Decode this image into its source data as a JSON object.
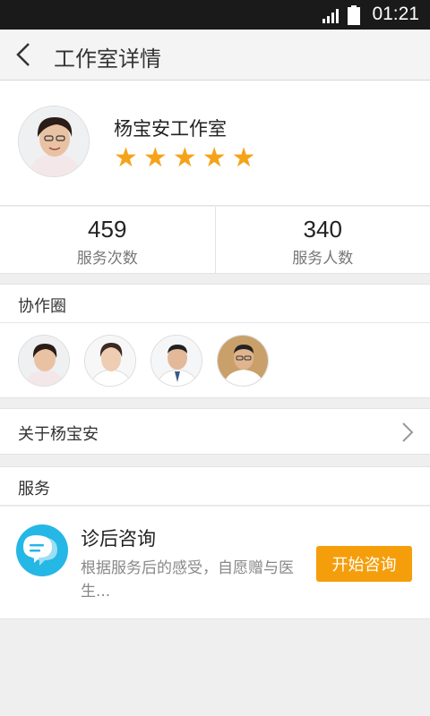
{
  "status_bar": {
    "time": "01:21"
  },
  "header": {
    "title": "工作室详情"
  },
  "profile": {
    "name": "杨宝安工作室",
    "rating": 5
  },
  "stats": [
    {
      "value": "459",
      "label": "服务次数"
    },
    {
      "value": "340",
      "label": "服务人数"
    }
  ],
  "collaboration": {
    "title": "协作圈",
    "member_count": 4
  },
  "about": {
    "label": "关于杨宝安"
  },
  "services": {
    "title": "服务",
    "items": [
      {
        "name": "诊后咨询",
        "description": "根据服务后的感受，自愿赠与医生...",
        "button_label": "开始咨询"
      }
    ]
  },
  "colors": {
    "accent": "#f59e0b",
    "star": "#f5a318",
    "service_icon": "#25b7e5",
    "status_bar": "#1a1a1a"
  }
}
